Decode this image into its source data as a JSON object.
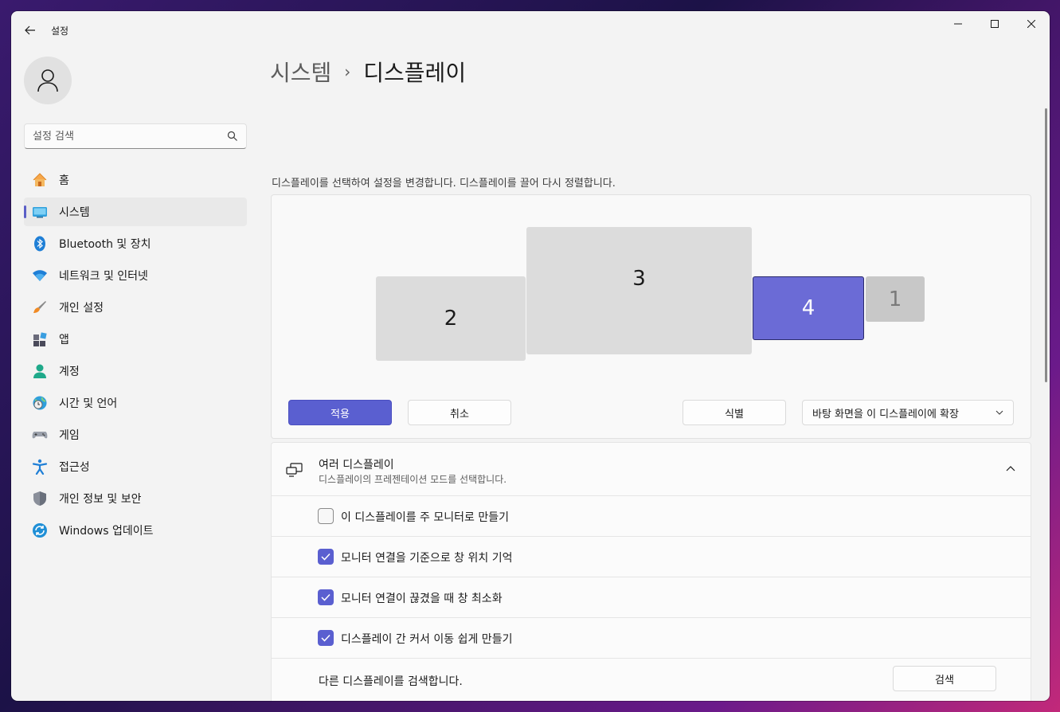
{
  "window": {
    "title": "설정",
    "controls": {
      "minimize": "minimize-icon",
      "maximize": "maximize-icon",
      "close": "close-icon"
    }
  },
  "sidebar": {
    "search_placeholder": "설정 검색",
    "items": [
      {
        "label": "홈",
        "icon": "home-icon",
        "active": false
      },
      {
        "label": "시스템",
        "icon": "system-display-icon",
        "active": true
      },
      {
        "label": "Bluetooth 및 장치",
        "icon": "bluetooth-icon",
        "active": false
      },
      {
        "label": "네트워크 및 인터넷",
        "icon": "wifi-icon",
        "active": false
      },
      {
        "label": "개인 설정",
        "icon": "brush-icon",
        "active": false
      },
      {
        "label": "앱",
        "icon": "apps-icon",
        "active": false
      },
      {
        "label": "계정",
        "icon": "account-icon",
        "active": false
      },
      {
        "label": "시간 및 언어",
        "icon": "clock-globe-icon",
        "active": false
      },
      {
        "label": "게임",
        "icon": "gamepad-icon",
        "active": false
      },
      {
        "label": "접근성",
        "icon": "accessibility-icon",
        "active": false
      },
      {
        "label": "개인 정보 및 보안",
        "icon": "shield-icon",
        "active": false
      },
      {
        "label": "Windows 업데이트",
        "icon": "update-icon",
        "active": false
      }
    ]
  },
  "main": {
    "breadcrumb": {
      "parent": "시스템",
      "separator": "›",
      "current": "디스플레이"
    },
    "hint": "디스플레이를 선택하여 설정을 변경합니다. 디스플레이를 끌어 다시 정렬합니다.",
    "monitors": [
      {
        "number": "2",
        "selected": false
      },
      {
        "number": "3",
        "selected": false
      },
      {
        "number": "4",
        "selected": true
      },
      {
        "number": "1",
        "selected": false
      }
    ],
    "apply_label": "적용",
    "cancel_label": "취소",
    "identify_label": "식별",
    "mode_dropdown": "바탕 화면을 이 디스플레이에 확장",
    "multi": {
      "title": "여러 디스플레이",
      "subtitle": "디스플레이의 프레젠테이션 모드를 선택합니다.",
      "options": [
        {
          "label": "이 디스플레이를 주 모니터로 만들기",
          "checked": false
        },
        {
          "label": "모니터 연결을 기준으로 창 위치 기억",
          "checked": true
        },
        {
          "label": "모니터 연결이 끊겼을 때 창 최소화",
          "checked": true
        },
        {
          "label": "디스플레이 간 커서 이동 쉽게 만들기",
          "checked": true
        }
      ],
      "detect_text": "다른 디스플레이를 검색합니다.",
      "detect_button": "검색"
    }
  },
  "colors": {
    "accent": "#5a5fd0",
    "selected_monitor": "#6b6bd6"
  }
}
